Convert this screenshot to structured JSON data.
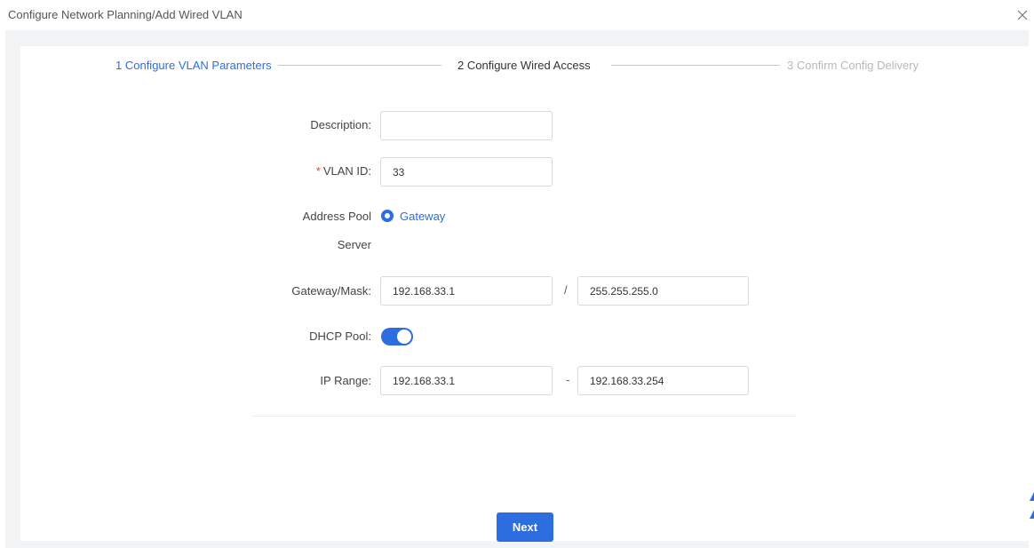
{
  "window": {
    "title": "Configure Network Planning/Add Wired VLAN",
    "close_icon": "close-icon"
  },
  "steps": [
    {
      "label": "1 Configure VLAN Parameters",
      "state": "active"
    },
    {
      "label": "2 Configure Wired Access",
      "state": "normal"
    },
    {
      "label": "3 Confirm Config Delivery",
      "state": "pending"
    }
  ],
  "form": {
    "description": {
      "label": "Description:",
      "value": ""
    },
    "vlan_id": {
      "required_mark": "*",
      "label": "VLAN ID:",
      "value": "33"
    },
    "address_pool": {
      "label_line1": "Address Pool",
      "label_line2": "Server",
      "option": "Gateway",
      "selected": true
    },
    "gateway_mask": {
      "label": "Gateway/Mask:",
      "gateway": "192.168.33.1",
      "separator": "/",
      "mask": "255.255.255.0"
    },
    "dhcp_pool": {
      "label": "DHCP Pool:",
      "enabled": true
    },
    "ip_range": {
      "label": "IP Range:",
      "start": "192.168.33.1",
      "separator": "-",
      "end": "192.168.33.254"
    }
  },
  "actions": {
    "next_label": "Next"
  },
  "colors": {
    "accent": "#2c6ee0",
    "required": "#e0463a",
    "pending": "#b8b8b8",
    "background": "#f2f3f5"
  }
}
